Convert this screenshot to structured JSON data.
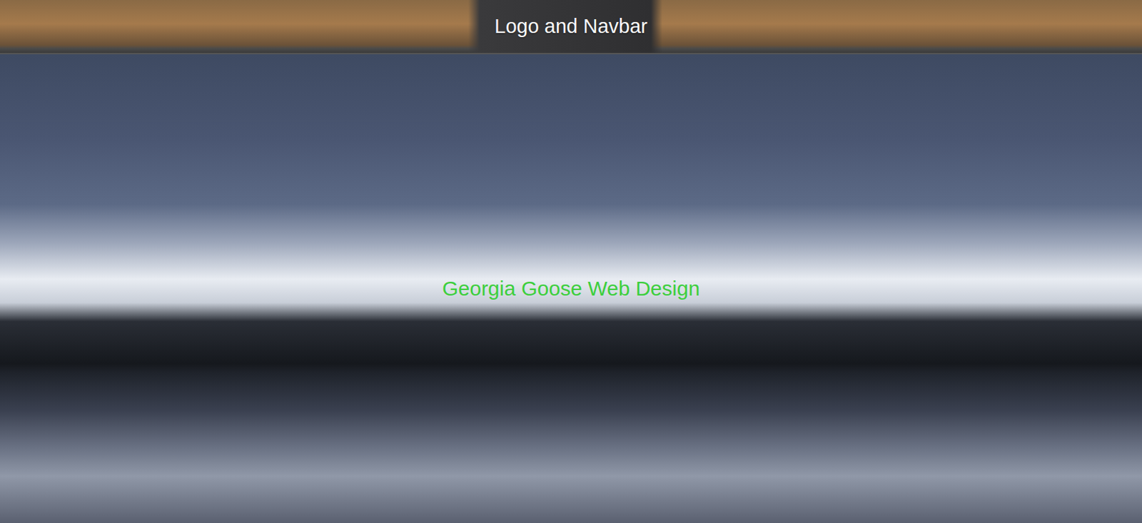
{
  "header": {
    "title": "Logo and Navbar"
  },
  "hero": {
    "title": "Georgia Goose Web Design"
  }
}
